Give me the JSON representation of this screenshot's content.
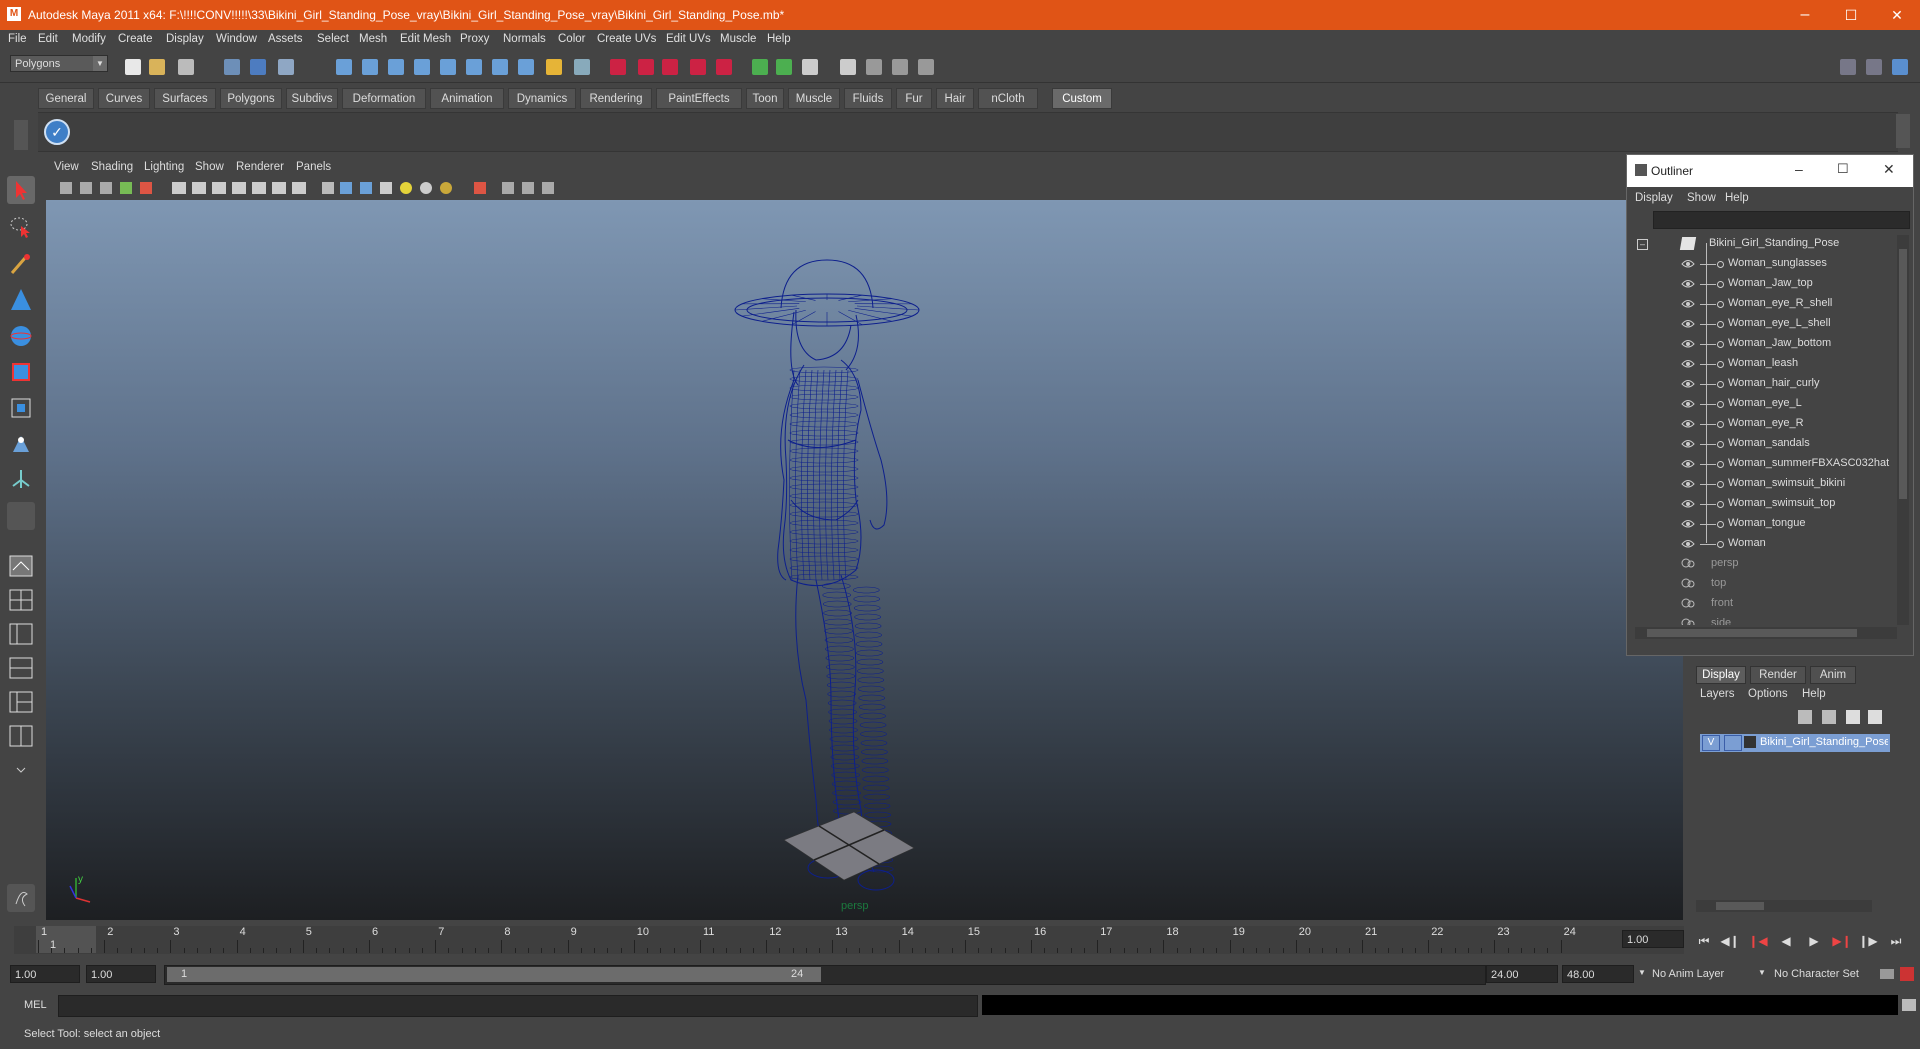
{
  "window": {
    "title": "Autodesk Maya 2011 x64: F:\\!!!!CONV!!!!!\\33\\Bikini_Girl_Standing_Pose_vray\\Bikini_Girl_Standing_Pose_vray\\Bikini_Girl_Standing_Pose.mb*",
    "minimize": "–",
    "maximize": "☐",
    "close": "✕"
  },
  "menubar": [
    "File",
    "Edit",
    "Modify",
    "Create",
    "Display",
    "Window",
    "Assets",
    "Select",
    "Mesh",
    "Edit Mesh",
    "Proxy",
    "Normals",
    "Color",
    "Create UVs",
    "Edit UVs",
    "Muscle",
    "Help"
  ],
  "statusline": {
    "mode": "Polygons"
  },
  "shelf": {
    "tabs": [
      "General",
      "Curves",
      "Surfaces",
      "Polygons",
      "Subdivs",
      "Deformation",
      "Animation",
      "Dynamics",
      "Rendering",
      "PaintEffects",
      "Toon",
      "Muscle",
      "Fluids",
      "Fur",
      "Hair",
      "nCloth",
      "Custom"
    ],
    "active": "Custom"
  },
  "viewport": {
    "menu": [
      "View",
      "Shading",
      "Lighting",
      "Show",
      "Renderer",
      "Panels"
    ],
    "camera": "persp",
    "axis_y": "y",
    "wire_color": "#0d1f8c"
  },
  "outliner": {
    "title": "Outliner",
    "menu": [
      "Display",
      "Show",
      "Help"
    ],
    "root": "Bikini_Girl_Standing_Pose",
    "children": [
      "Woman_sunglasses",
      "Woman_Jaw_top",
      "Woman_eye_R_shell",
      "Woman_eye_L_shell",
      "Woman_Jaw_bottom",
      "Woman_leash",
      "Woman_hair_curly",
      "Woman_eye_L",
      "Woman_eye_R",
      "Woman_sandals",
      "Woman_summerFBXASC032hat",
      "Woman_swimsuit_bikini",
      "Woman_swimsuit_top",
      "Woman_tongue",
      "Woman"
    ],
    "cameras": [
      "persp",
      "top",
      "front",
      "side"
    ]
  },
  "layers": {
    "tabs": [
      "Display",
      "Render",
      "Anim"
    ],
    "menu": [
      "Layers",
      "Options",
      "Help"
    ],
    "visible": "V",
    "layer_name": "Bikini_Girl_Standing_Pose"
  },
  "timeline": {
    "numbers": [
      "1",
      "2",
      "3",
      "4",
      "5",
      "6",
      "7",
      "8",
      "9",
      "10",
      "11",
      "12",
      "13",
      "14",
      "15",
      "16",
      "17",
      "18",
      "19",
      "20",
      "21",
      "22",
      "23",
      "24"
    ],
    "current": "1",
    "current_field": "1.00"
  },
  "range": {
    "start": "1.00",
    "inner_start": "1.00",
    "slider_start": "1",
    "slider_end": "24",
    "end": "24.00",
    "outer_end": "48.00",
    "anim_layer": "No Anim Layer",
    "char_set": "No Character Set"
  },
  "command": {
    "label": "MEL"
  },
  "help": {
    "text": "Select Tool: select an object"
  }
}
